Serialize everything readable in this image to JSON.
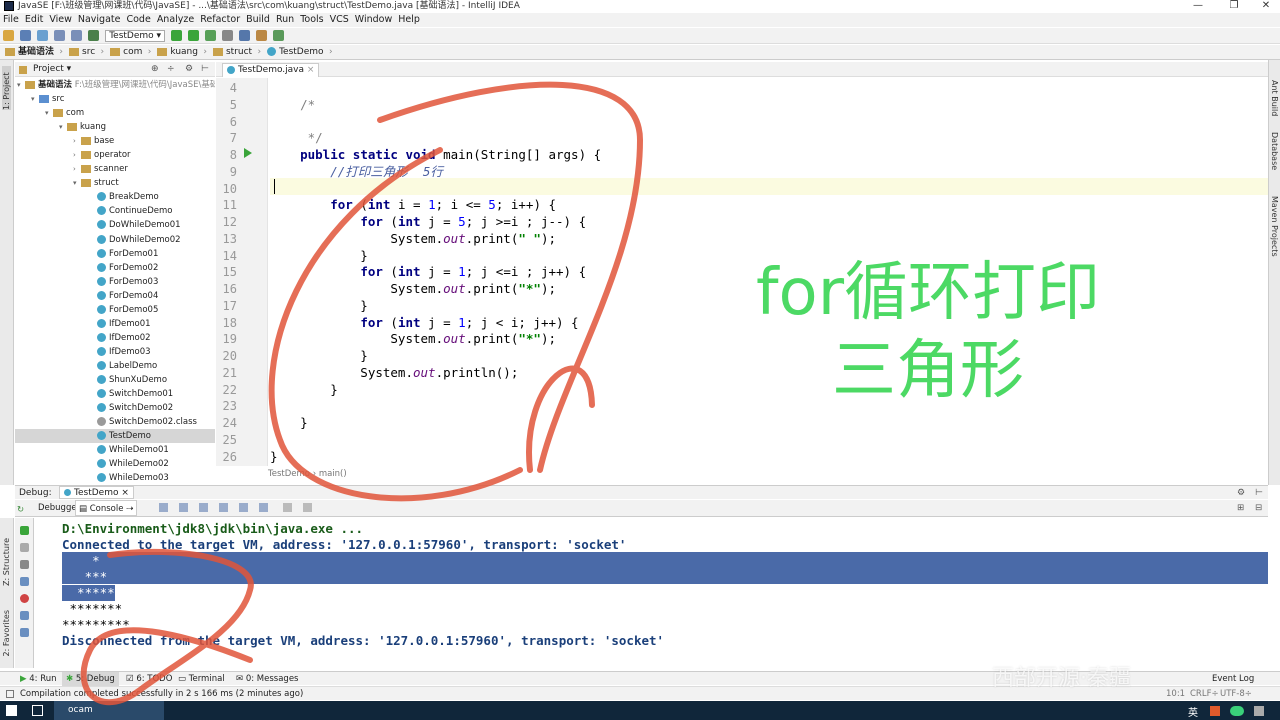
{
  "window": {
    "title": "JavaSE [F:\\班级管理\\网课班\\代码\\JavaSE] - ...\\基础语法\\src\\com\\kuang\\struct\\TestDemo.java [基础语法] - IntelliJ IDEA",
    "min": "—",
    "max": "❐",
    "close": "✕"
  },
  "menu": [
    "File",
    "Edit",
    "View",
    "Navigate",
    "Code",
    "Analyze",
    "Refactor",
    "Build",
    "Run",
    "Tools",
    "VCS",
    "Window",
    "Help"
  ],
  "toolbar": {
    "run_config": "TestDemo ▾"
  },
  "breadcrumbs": [
    "基础语法",
    "src",
    "com",
    "kuang",
    "struct",
    "TestDemo"
  ],
  "side_tabs": {
    "project": "1: Project",
    "structure": "Z: Structure",
    "favorites": "2: Favorites",
    "ant": "Ant Build",
    "database": "Database",
    "maven": "Maven Projects"
  },
  "project": {
    "header": "Project ▾",
    "root_label": "基础语法",
    "root_path": "F:\\班级管理\\网课班\\代码\\JavaSE\\基础语",
    "src": "src",
    "com": "com",
    "kuang": "kuang",
    "packages": [
      "base",
      "operator",
      "scanner"
    ],
    "struct": "struct",
    "files": [
      "BreakDemo",
      "ContinueDemo",
      "DoWhileDemo01",
      "DoWhileDemo02",
      "ForDemo01",
      "ForDemo02",
      "ForDemo03",
      "ForDemo04",
      "ForDemo05",
      "IfDemo01",
      "IfDemo02",
      "IfDemo03",
      "LabelDemo",
      "ShunXuDemo",
      "SwitchDemo01",
      "SwitchDemo02",
      "SwitchDemo02.class",
      "TestDemo",
      "WhileDemo01",
      "WhileDemo02",
      "WhileDemo03"
    ],
    "selected": "TestDemo"
  },
  "editor": {
    "tab": "TestDemo.java",
    "line_numbers": [
      "4",
      "5",
      "6",
      "7",
      "8",
      "9",
      "10",
      "11",
      "12",
      "13",
      "14",
      "15",
      "16",
      "17",
      "18",
      "19",
      "20",
      "21",
      "22",
      "23",
      "24",
      "25",
      "26"
    ],
    "code_breadcrumb": [
      "TestDemo",
      "main()"
    ]
  },
  "overlay_text": "for循环打印\n三角形",
  "debug": {
    "label": "Debug:",
    "session": "TestDemo",
    "tabs": [
      "Debugger",
      "Console"
    ],
    "console_lines": [
      "D:\\Environment\\jdk8\\jdk\\bin\\java.exe ...",
      "Connected to the target VM, address: '127.0.0.1:57960', transport: 'socket'",
      "    *",
      "   ***",
      "  *****",
      " *******",
      "*********",
      "Disconnected from the target VM, address: '127.0.0.1:57960', transport: 'socket'"
    ]
  },
  "bottom_tabs": [
    "4: Run",
    "5: Debug",
    "6: TODO",
    "Terminal",
    "0: Messages"
  ],
  "event_log": "Event Log",
  "status": {
    "message": "Compilation completed successfully in 2 s 166 ms (2 minutes ago)",
    "position": "10:1",
    "line_sep": "CRLF÷",
    "encoding": "UTF-8÷"
  },
  "watermark": "西部开源·秦疆",
  "taskbar": {
    "app": "ocam",
    "lang": "英"
  }
}
